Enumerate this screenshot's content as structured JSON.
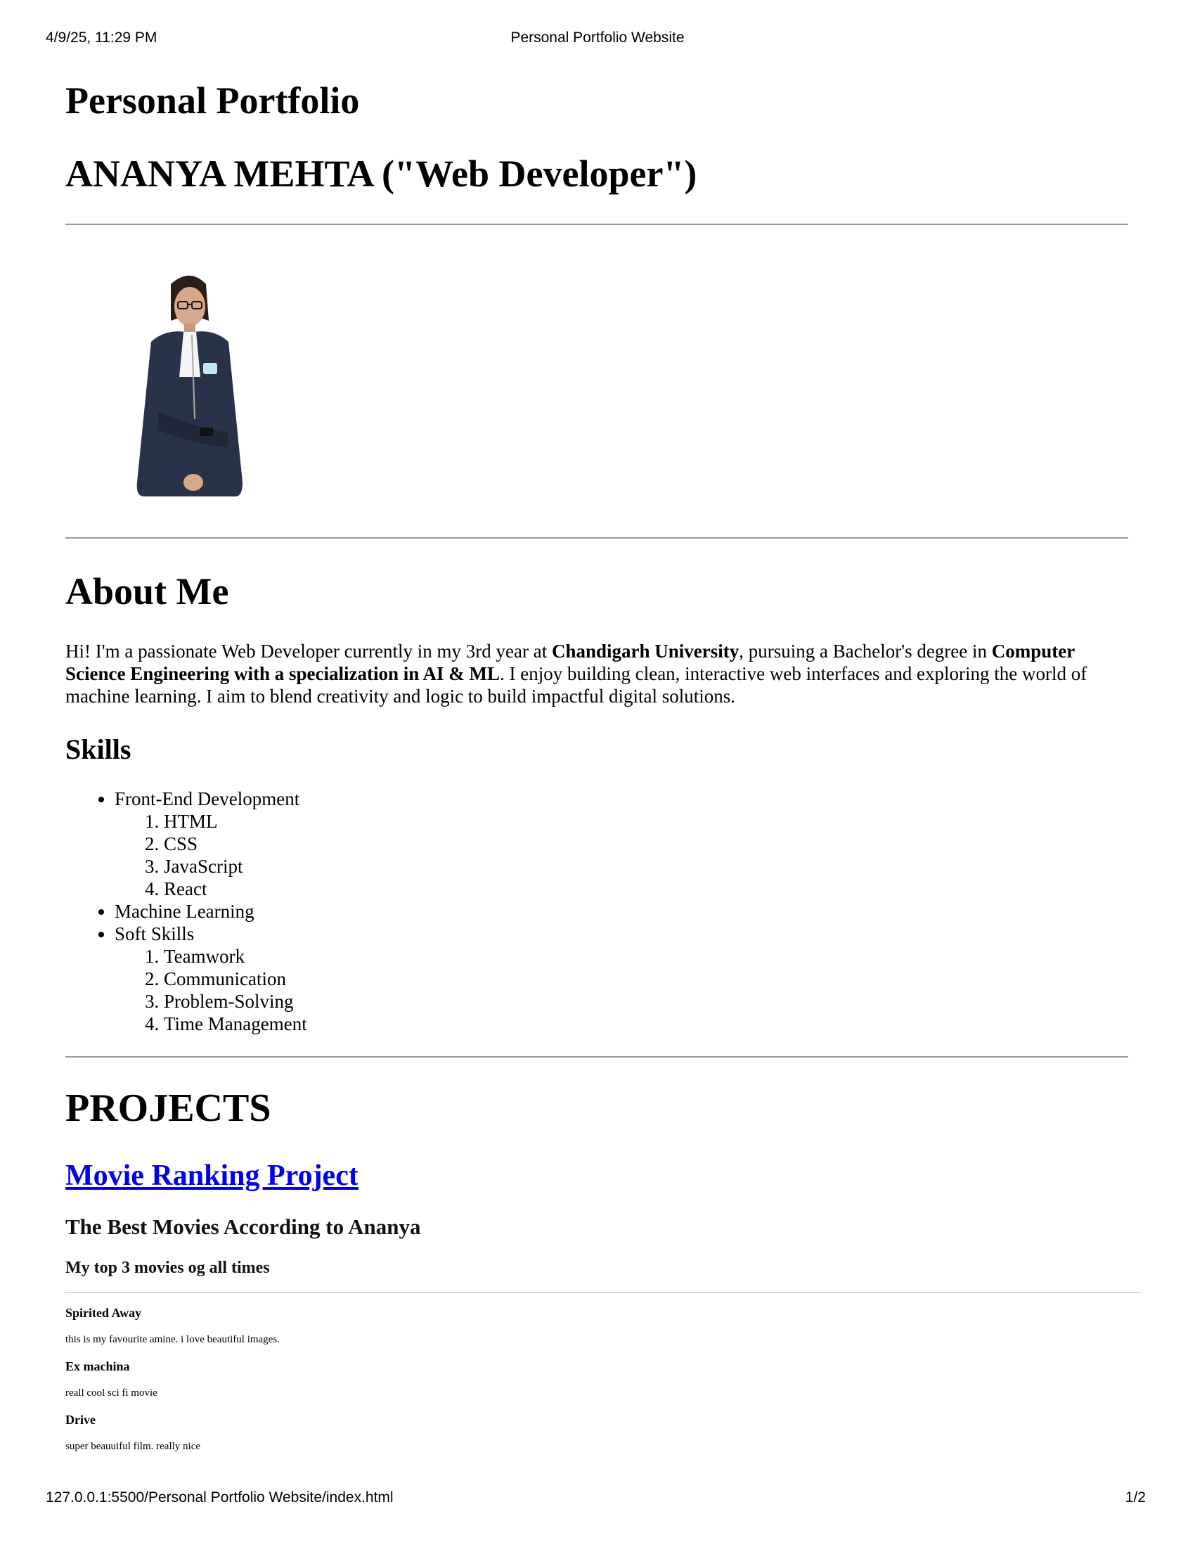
{
  "print_header": {
    "datetime": "4/9/25, 11:29 PM",
    "title": "Personal Portfolio Website"
  },
  "print_footer": {
    "url": "127.0.0.1:5500/Personal Portfolio Website/index.html",
    "page": "1/2"
  },
  "page": {
    "title": "Personal Portfolio",
    "name_heading": "ANANYA MEHTA (\"Web Developer\")",
    "photo_alt": "profile photo"
  },
  "about": {
    "heading": "About Me",
    "text_1": "Hi! I'm a passionate Web Developer currently in my 3rd year at ",
    "bold_1": "Chandigarh University",
    "text_2": ", pursuing a Bachelor's degree in ",
    "bold_2": "Computer Science Engineering with a specialization in AI & ML",
    "text_3": ". I enjoy building clean, interactive web interfaces and exploring the world of machine learning. I aim to blend creativity and logic to build impactful digital solutions."
  },
  "skills": {
    "heading": "Skills",
    "groups": [
      {
        "label": "Front-End Development",
        "items": [
          "HTML",
          "CSS",
          "JavaScript",
          "React"
        ]
      },
      {
        "label": "Machine Learning",
        "items": []
      },
      {
        "label": "Soft Skills",
        "items": [
          "Teamwork",
          "Communication",
          "Problem-Solving",
          "Time Management"
        ]
      }
    ]
  },
  "projects": {
    "heading": "PROJECTS",
    "link_label": "Movie Ranking Project",
    "embed": {
      "title": "The Best Movies According to Ananya",
      "subtitle": "My top 3 movies og all times",
      "movies": [
        {
          "title": "Spirited Away",
          "desc": "this is my favourite amine. i love beautiful images."
        },
        {
          "title": "Ex machina",
          "desc": "reall cool sci fi movie"
        },
        {
          "title": "Drive",
          "desc": "super beauuiful film. really nice"
        }
      ]
    }
  }
}
